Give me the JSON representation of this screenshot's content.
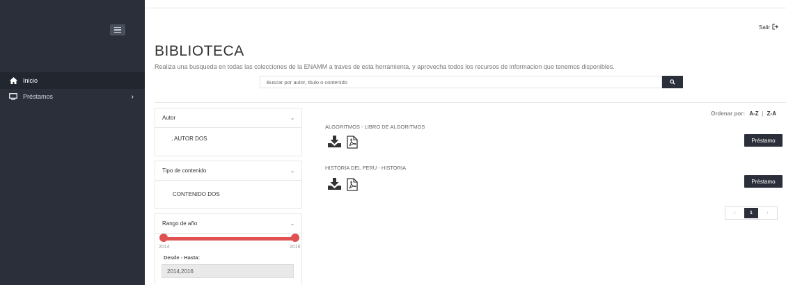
{
  "sidebar": {
    "toggle_icon": "hamburger-icon",
    "items": [
      {
        "label": "Inicio",
        "icon": "home-icon",
        "active": true
      },
      {
        "label": "Préstamos",
        "icon": "monitor-icon",
        "active": false
      }
    ]
  },
  "header": {
    "logout_label": "Salir",
    "logout_icon": "logout-icon"
  },
  "main": {
    "title": "BIBLIOTECA",
    "subtitle": "Realiza una busqueda en todas las colecciones de la ENAMM a traves de esta herramienta, y aprovecha todos los recursos de informacion que tenemos disponibles.",
    "search": {
      "placeholder": "Buscar por autor, titulo o contenido",
      "value": ""
    }
  },
  "filters": {
    "autor": {
      "label": "Autor",
      "items": [
        ", AUTOR DOS"
      ]
    },
    "tipo": {
      "label": "Tipo de contenido",
      "items": [
        "CONTENIDO DOS"
      ]
    },
    "rango": {
      "label": "Rango de año",
      "min": "2014",
      "max": "2016",
      "range_label": "Desde - Hasta:",
      "value": "2014,2016"
    }
  },
  "sort": {
    "label": "Ordenar por:",
    "options": [
      "A-Z",
      "Z-A"
    ],
    "separator": "|"
  },
  "results": [
    {
      "title": "ALGORITMOS - LIBRO DE ALGORITMOS",
      "button": "Préstamo"
    },
    {
      "title": "HISTORIA DEL PERU - HISTORIA",
      "button": "Préstamo"
    }
  ],
  "pagination": {
    "prev": "‹",
    "current": "1",
    "next": "›"
  },
  "colors": {
    "sidebar": "#2b2f3a",
    "accent": "#e05252"
  }
}
